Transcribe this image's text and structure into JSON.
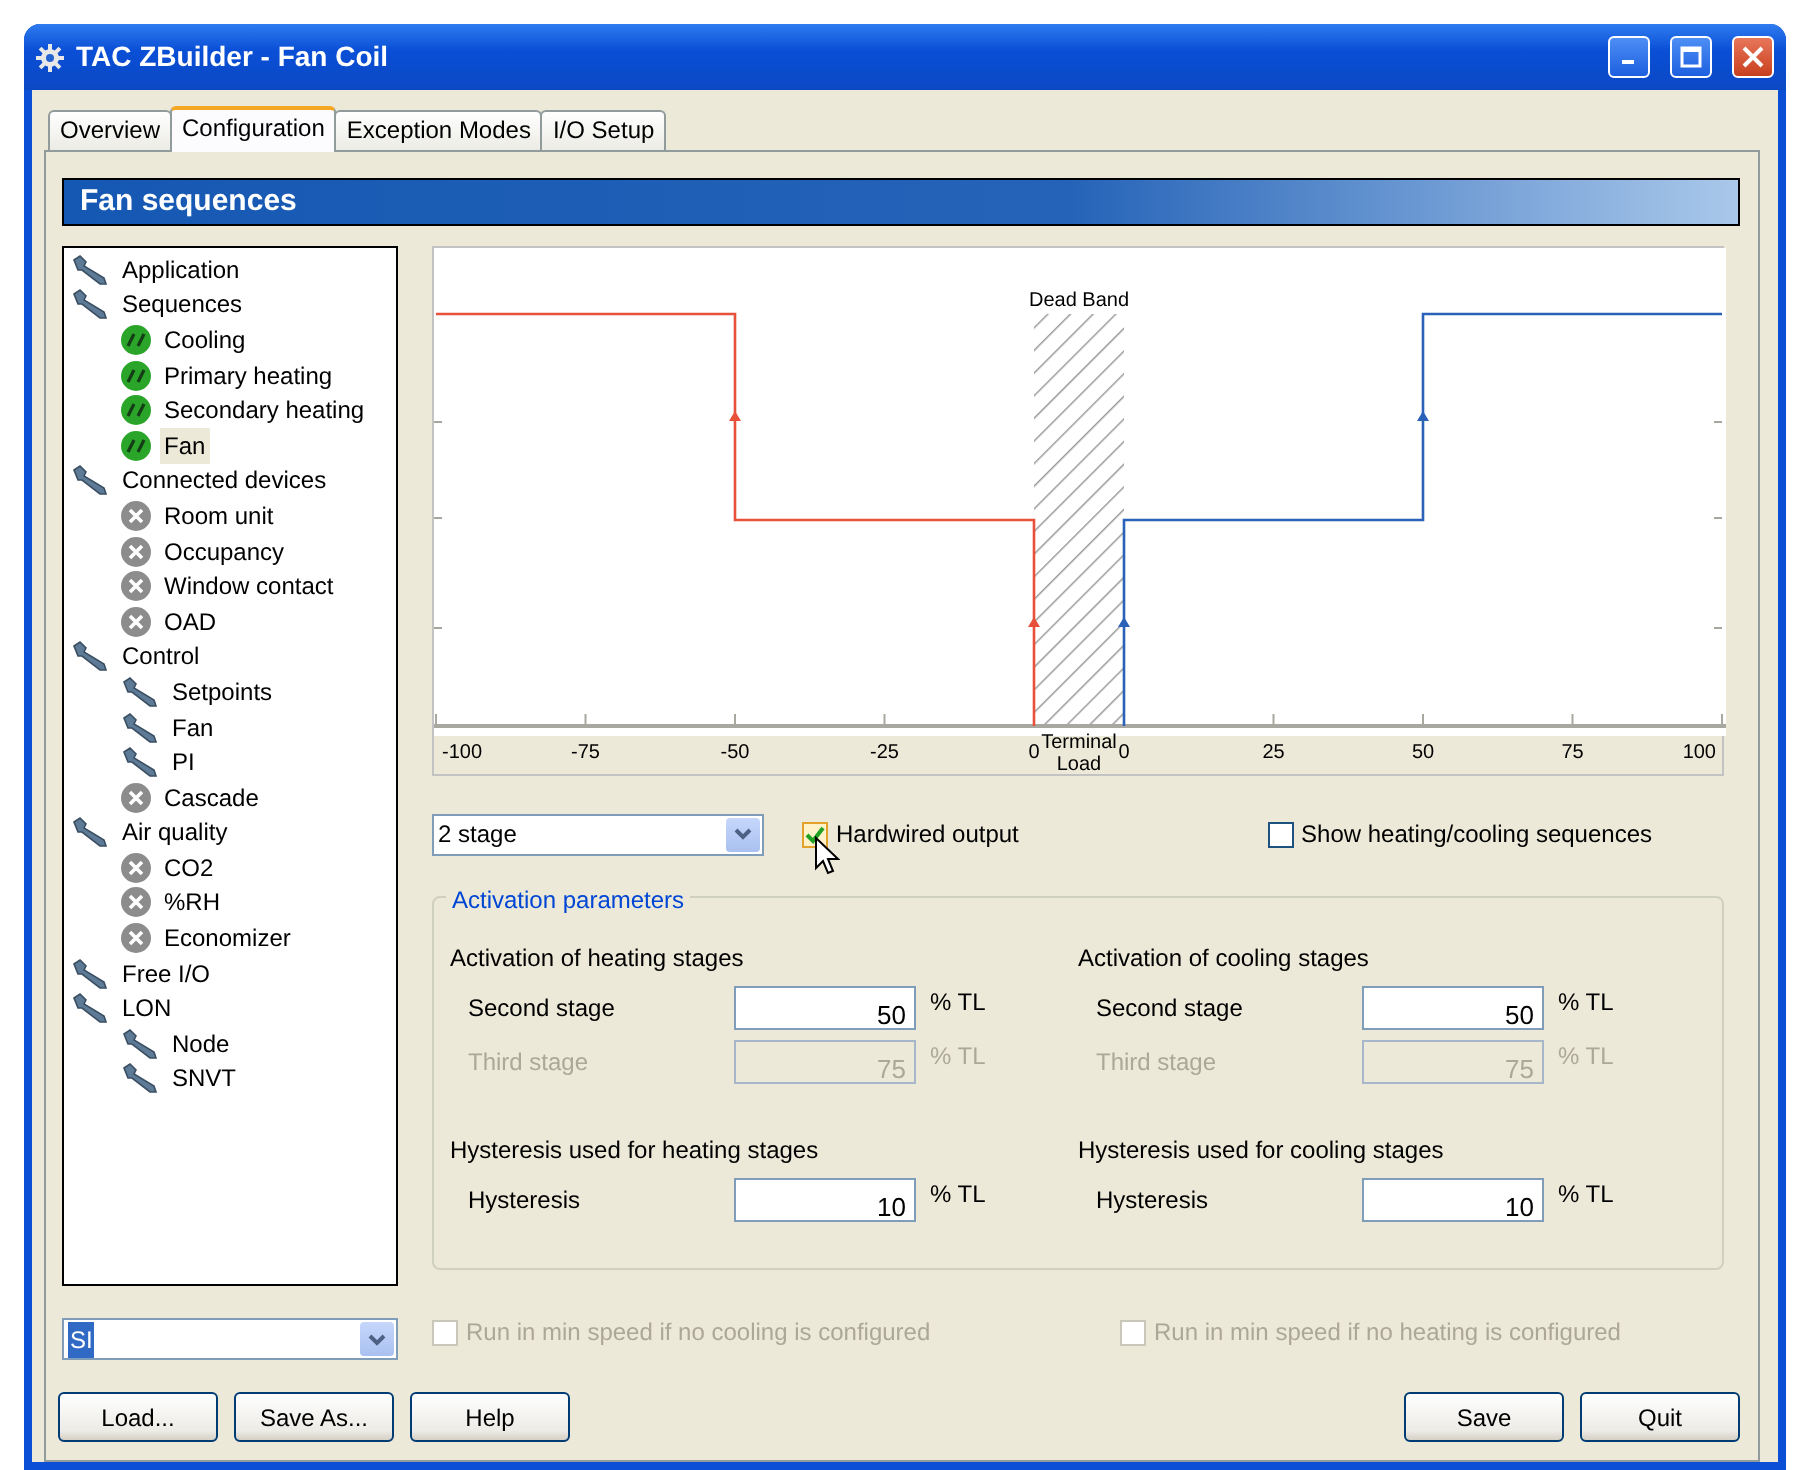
{
  "window": {
    "title": "TAC ZBuilder - Fan Coil"
  },
  "tabs": [
    {
      "label": "Overview",
      "selected": false
    },
    {
      "label": "Configuration",
      "selected": true
    },
    {
      "label": "Exception Modes",
      "selected": false
    },
    {
      "label": "I/O Setup",
      "selected": false
    }
  ],
  "panel_title": "Fan sequences",
  "tree": [
    {
      "label": "Application",
      "kind": "wrench",
      "selected": false
    },
    {
      "label": "Sequences",
      "kind": "wrench",
      "selected": false,
      "children": [
        {
          "label": "Cooling",
          "kind": "io",
          "selected": false
        },
        {
          "label": "Primary heating",
          "kind": "io",
          "selected": false
        },
        {
          "label": "Secondary heating",
          "kind": "io",
          "selected": false
        },
        {
          "label": "Fan",
          "kind": "io",
          "selected": true
        }
      ]
    },
    {
      "label": "Connected devices",
      "kind": "wrench",
      "selected": false,
      "children": [
        {
          "label": "Room unit",
          "kind": "off",
          "selected": false
        },
        {
          "label": "Occupancy",
          "kind": "off",
          "selected": false
        },
        {
          "label": "Window contact",
          "kind": "off",
          "selected": false
        },
        {
          "label": "OAD",
          "kind": "off",
          "selected": false
        }
      ]
    },
    {
      "label": "Control",
      "kind": "wrench",
      "selected": false,
      "children": [
        {
          "label": "Setpoints",
          "kind": "wrench",
          "selected": false
        },
        {
          "label": "Fan",
          "kind": "wrench",
          "selected": false
        },
        {
          "label": "PI",
          "kind": "wrench",
          "selected": false
        },
        {
          "label": "Cascade",
          "kind": "off",
          "selected": false
        }
      ]
    },
    {
      "label": "Air quality",
      "kind": "wrench",
      "selected": false,
      "children": [
        {
          "label": "CO2",
          "kind": "off",
          "selected": false
        },
        {
          "label": "%RH",
          "kind": "off",
          "selected": false
        },
        {
          "label": "Economizer",
          "kind": "off",
          "selected": false
        }
      ]
    },
    {
      "label": "Free I/O",
      "kind": "wrench",
      "selected": false
    },
    {
      "label": "LON",
      "kind": "wrench",
      "selected": false,
      "children": [
        {
          "label": "Node",
          "kind": "wrench",
          "selected": false
        },
        {
          "label": "SNVT",
          "kind": "wrench",
          "selected": false
        }
      ]
    }
  ],
  "unit_select": {
    "value": "SI"
  },
  "chart": {
    "axis_labels": [
      "-100",
      "-75",
      "-50",
      "-25",
      "0",
      "0",
      "25",
      "50",
      "75",
      "100"
    ],
    "dead_band_label": "Dead Band",
    "terminal_load_label": "Terminal Load"
  },
  "stage_select": {
    "value": "2 stage"
  },
  "hardwired": {
    "label": "Hardwired output",
    "checked": true
  },
  "show_sequences": {
    "label": "Show heating/cooling sequences",
    "checked": false
  },
  "activation": {
    "legend": "Activation parameters",
    "columns": [
      {
        "blocks": [
          {
            "heading": "Activation of heating stages",
            "fields": [
              {
                "label": "Second stage",
                "value": "50",
                "unit": "% TL",
                "disabled": false
              },
              {
                "label": "Third stage",
                "value": "75",
                "unit": "% TL",
                "disabled": true
              }
            ]
          },
          {
            "heading": "Hysteresis used for heating stages",
            "fields": [
              {
                "label": "Hysteresis",
                "value": "10",
                "unit": "% TL",
                "disabled": false
              }
            ]
          }
        ]
      },
      {
        "blocks": [
          {
            "heading": "Activation of cooling stages",
            "fields": [
              {
                "label": "Second stage",
                "value": "50",
                "unit": "% TL",
                "disabled": false
              },
              {
                "label": "Third stage",
                "value": "75",
                "unit": "% TL",
                "disabled": true
              }
            ]
          },
          {
            "heading": "Hysteresis used for cooling stages",
            "fields": [
              {
                "label": "Hysteresis",
                "value": "10",
                "unit": "% TL",
                "disabled": false
              }
            ]
          }
        ]
      }
    ]
  },
  "run_options": [
    {
      "label": "Run in min speed if no cooling is configured",
      "checked": false,
      "disabled": true
    },
    {
      "label": "Run in min speed if no heating is configured",
      "checked": false,
      "disabled": true
    }
  ],
  "buttons_left": [
    "Load...",
    "Save As...",
    "Help"
  ],
  "buttons_right": [
    "Save",
    "Quit"
  ]
}
